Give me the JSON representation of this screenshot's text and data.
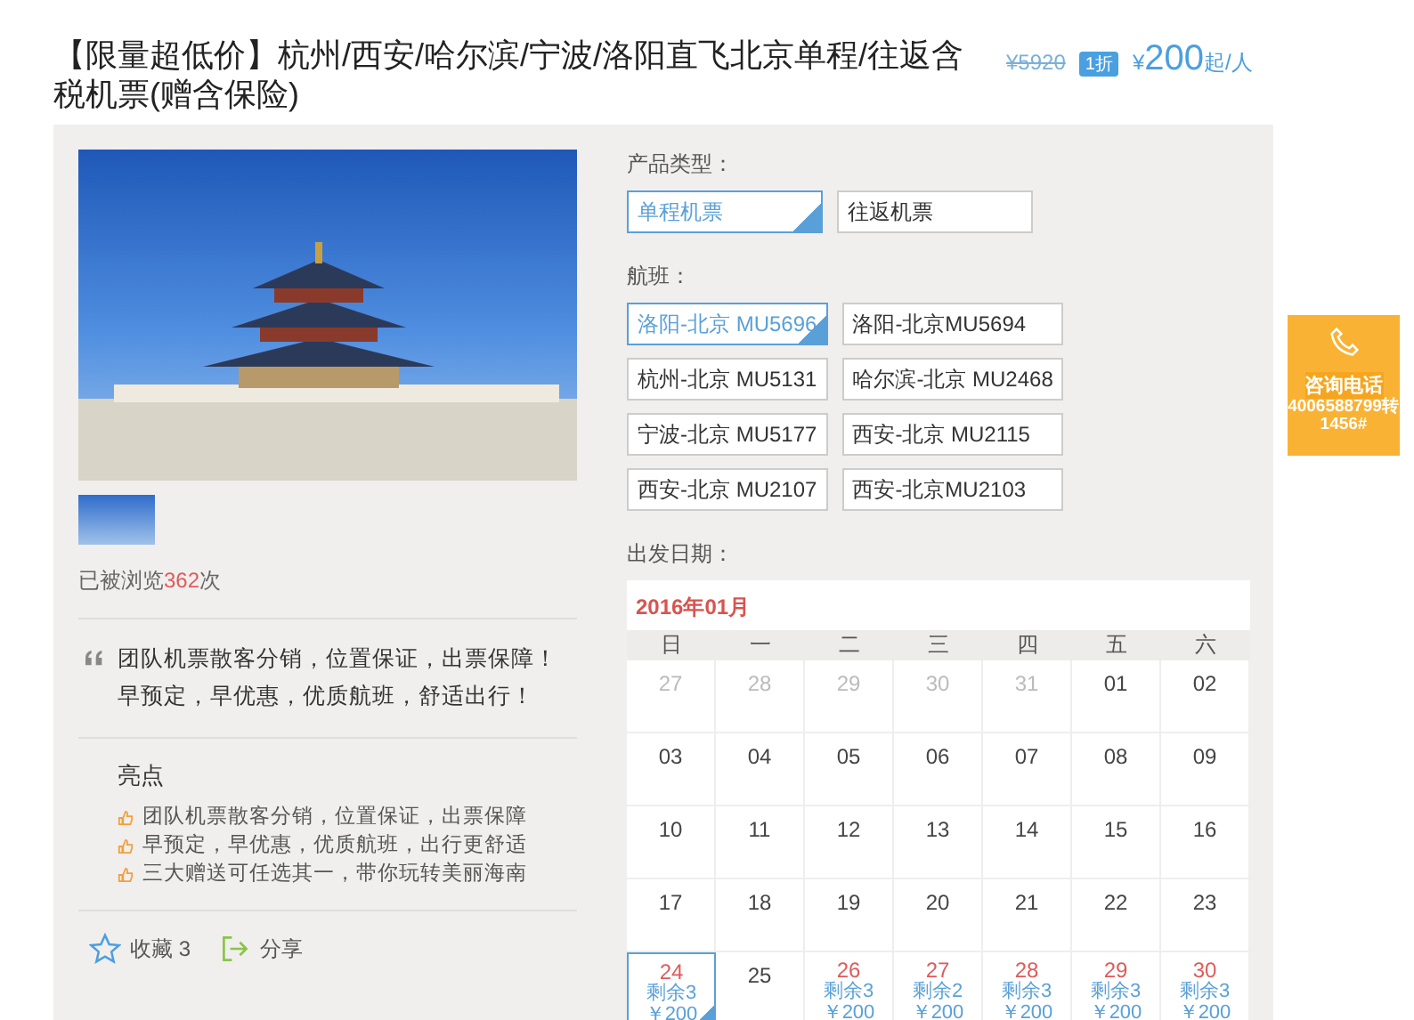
{
  "title": "【限量超低价】杭州/西安/哈尔滨/宁波/洛阳直飞北京单程/往返含税机票(赠含保险)",
  "price": {
    "original": "¥5920",
    "discount": "1折",
    "currency": "¥",
    "amount": "200",
    "unit": "起/人"
  },
  "gallery": {
    "views_prefix": "已被浏览",
    "views_count": "362",
    "views_suffix": "次"
  },
  "quote": "团队机票散客分销，位置保证，出票保障！早预定，早优惠，优质航班，舒适出行！",
  "highlights": {
    "heading": "亮点",
    "items": [
      "团队机票散客分销，位置保证，出票保障",
      "早预定，早优惠，优质航班，出行更舒适",
      "三大赠送可任选其一，带你玩转美丽海南"
    ]
  },
  "actions": [
    {
      "kind": "favorite",
      "label": "收藏 3"
    },
    {
      "kind": "share",
      "label": "分享"
    }
  ],
  "product_type": {
    "label": "产品类型：",
    "options": [
      {
        "label": "单程机票",
        "selected": true
      },
      {
        "label": "往返机票",
        "selected": false
      }
    ]
  },
  "flights": {
    "label": "航班：",
    "options": [
      {
        "label": "洛阳-北京 MU5696",
        "selected": true
      },
      {
        "label": "洛阳-北京MU5694",
        "selected": false
      },
      {
        "label": "杭州-北京 MU5131",
        "selected": false
      },
      {
        "label": "哈尔滨-北京 MU2468",
        "selected": false
      },
      {
        "label": "宁波-北京 MU5177",
        "selected": false
      },
      {
        "label": "西安-北京 MU2115",
        "selected": false
      },
      {
        "label": "西安-北京 MU2107",
        "selected": false
      },
      {
        "label": "西安-北京MU2103",
        "selected": false
      }
    ]
  },
  "calendar": {
    "label": "出发日期：",
    "month": "2016年01月",
    "weekdays": [
      "日",
      "一",
      "二",
      "三",
      "四",
      "五",
      "六"
    ],
    "days": [
      {
        "day": "27",
        "kind": "other"
      },
      {
        "day": "28",
        "kind": "other"
      },
      {
        "day": "29",
        "kind": "other"
      },
      {
        "day": "30",
        "kind": "other"
      },
      {
        "day": "31",
        "kind": "other"
      },
      {
        "day": "01",
        "kind": "normal"
      },
      {
        "day": "02",
        "kind": "normal"
      },
      {
        "day": "03",
        "kind": "normal"
      },
      {
        "day": "04",
        "kind": "normal"
      },
      {
        "day": "05",
        "kind": "normal"
      },
      {
        "day": "06",
        "kind": "normal"
      },
      {
        "day": "07",
        "kind": "normal"
      },
      {
        "day": "08",
        "kind": "normal"
      },
      {
        "day": "09",
        "kind": "normal"
      },
      {
        "day": "10",
        "kind": "normal"
      },
      {
        "day": "11",
        "kind": "normal"
      },
      {
        "day": "12",
        "kind": "normal"
      },
      {
        "day": "13",
        "kind": "normal"
      },
      {
        "day": "14",
        "kind": "normal"
      },
      {
        "day": "15",
        "kind": "normal"
      },
      {
        "day": "16",
        "kind": "normal"
      },
      {
        "day": "17",
        "kind": "normal"
      },
      {
        "day": "18",
        "kind": "normal"
      },
      {
        "day": "19",
        "kind": "normal"
      },
      {
        "day": "20",
        "kind": "normal"
      },
      {
        "day": "21",
        "kind": "normal"
      },
      {
        "day": "22",
        "kind": "normal"
      },
      {
        "day": "23",
        "kind": "normal"
      },
      {
        "day": "24",
        "kind": "available",
        "stock": "剩余3",
        "price": "￥200",
        "selected": true
      },
      {
        "day": "25",
        "kind": "normal"
      },
      {
        "day": "26",
        "kind": "available",
        "stock": "剩余3",
        "price": "￥200",
        "selected": false
      },
      {
        "day": "27",
        "kind": "available",
        "stock": "剩余2",
        "price": "￥200",
        "selected": false
      },
      {
        "day": "28",
        "kind": "available",
        "stock": "剩余3",
        "price": "￥200",
        "selected": false
      },
      {
        "day": "29",
        "kind": "available",
        "stock": "剩余3",
        "price": "￥200",
        "selected": false
      },
      {
        "day": "30",
        "kind": "available",
        "stock": "剩余3",
        "price": "￥200",
        "selected": false
      }
    ]
  },
  "hotline": {
    "label": "咨询电话",
    "number": "4006588799转1456#"
  }
}
